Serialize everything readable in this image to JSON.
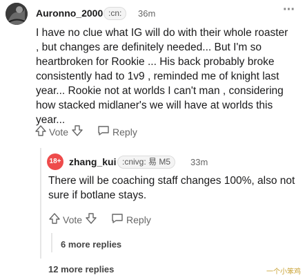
{
  "comment1": {
    "username": "Auronno_2000",
    "flair": ":cn:",
    "time": "36m",
    "more_icon": "more-dots-icon",
    "body_lines": [
      "I have no clue what IG will do with their whole roaster",
      ", but changes are definitely needed... But I'm so",
      "heartbroken for Rookie ... His back probably broke",
      "consistently had to 1v9 , reminded me of knight last",
      "year... Rookie not at worlds I can't man , considering",
      "how stacked midlaner's we will have at worlds this",
      "year..."
    ],
    "vote_label": "Vote",
    "reply_label": "Reply"
  },
  "comment2": {
    "badge": "18+",
    "username": "zhang_kui",
    "flair": ":cnivg: 易 M5",
    "time": "33m",
    "body_lines": [
      "There will be coaching staff changes 100%, also not",
      "sure if botlane stays."
    ],
    "vote_label": "Vote",
    "reply_label": "Reply"
  },
  "more_replies_nested": "6 more replies",
  "more_replies_top": "12 more replies",
  "watermark": "一个小笨鸡",
  "colors": {
    "badge_bg": "#ee4b4b",
    "text": "#1a1a1b",
    "muted": "#666666"
  }
}
